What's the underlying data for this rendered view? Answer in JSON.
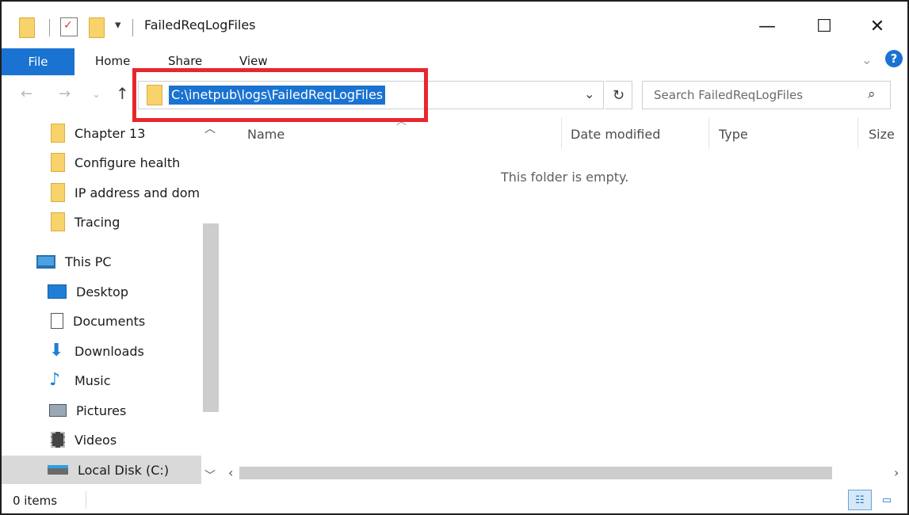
{
  "window": {
    "title": "FailedReqLogFiles",
    "minimize_glyph": "—",
    "maximize_glyph": "☐",
    "close_glyph": "✕"
  },
  "ribbon": {
    "file_label": "File",
    "tabs": [
      "Home",
      "Share",
      "View"
    ]
  },
  "address": {
    "path": "C:\\inetpub\\logs\\FailedReqLogFiles"
  },
  "search": {
    "placeholder": "Search FailedReqLogFiles"
  },
  "nav_pane": {
    "items": [
      {
        "label": "Chapter 13",
        "icon": "folder-icon"
      },
      {
        "label": "Configure health",
        "icon": "folder-icon"
      },
      {
        "label": "IP address and dom",
        "icon": "folder-icon"
      },
      {
        "label": "Tracing",
        "icon": "folder-icon"
      },
      {
        "label": "This PC",
        "icon": "computer-icon"
      },
      {
        "label": "Desktop",
        "icon": "desktop-icon"
      },
      {
        "label": "Documents",
        "icon": "documents-icon"
      },
      {
        "label": "Downloads",
        "icon": "downloads-icon"
      },
      {
        "label": "Music",
        "icon": "music-icon"
      },
      {
        "label": "Pictures",
        "icon": "pictures-icon"
      },
      {
        "label": "Videos",
        "icon": "videos-icon"
      },
      {
        "label": "Local Disk (C:)",
        "icon": "local-disk-icon"
      }
    ],
    "selected": "Local Disk (C:)"
  },
  "content": {
    "columns": [
      "Name",
      "Date modified",
      "Type",
      "Size"
    ],
    "empty_message": "This folder is empty."
  },
  "status": {
    "item_count": "0 items"
  },
  "colors": {
    "accent": "#1a73d1",
    "highlight_border": "#e8272d",
    "folder": "#f8d26a"
  }
}
